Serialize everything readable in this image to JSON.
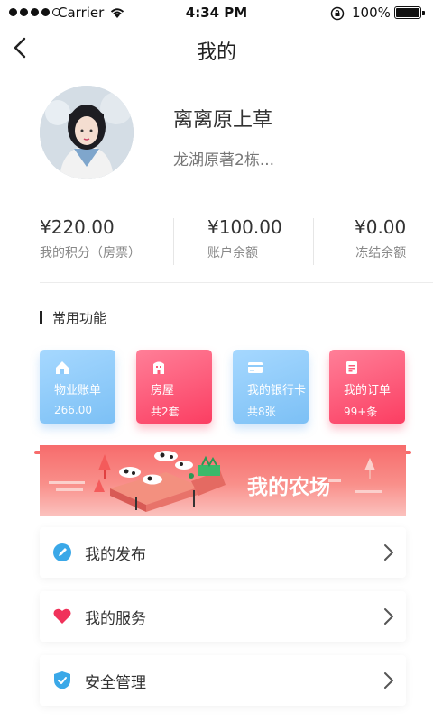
{
  "status_bar": {
    "carrier": "Carrier",
    "time": "4:34 PM",
    "battery": "100%"
  },
  "nav": {
    "title": "我的",
    "back_icon": "chevron-left-icon"
  },
  "profile": {
    "name": "离离原上草",
    "address": "龙湖原著2栋..."
  },
  "balances": [
    {
      "amount": "¥220.00",
      "label": "我的积分（房票）"
    },
    {
      "amount": "¥100.00",
      "label": "账户余额"
    },
    {
      "amount": "¥0.00",
      "label": "冻结余额"
    }
  ],
  "section": {
    "title": "常用功能"
  },
  "cards": [
    {
      "title": "物业账单",
      "sub": "266.00",
      "icon": "house-icon",
      "color": "#8fcbfa"
    },
    {
      "title": "房屋",
      "sub": "共2套",
      "icon": "building-icon",
      "color": "#fc5b78"
    },
    {
      "title": "我的银行卡",
      "sub": "共8张",
      "icon": "bank-card-icon",
      "color": "#8fcbfa"
    },
    {
      "title": "我的订单",
      "sub": "99+条",
      "icon": "order-icon",
      "color": "#fc5b78"
    }
  ],
  "banner": {
    "title": "我的农场",
    "color": "#f76c6c"
  },
  "menu": [
    {
      "label": "我的发布",
      "icon": "edit-icon",
      "color": "#3aa8e8"
    },
    {
      "label": "我的服务",
      "icon": "heart-icon",
      "color": "#f0325a"
    },
    {
      "label": "安全管理",
      "icon": "shield-check-icon",
      "color": "#3aa8e8"
    }
  ]
}
